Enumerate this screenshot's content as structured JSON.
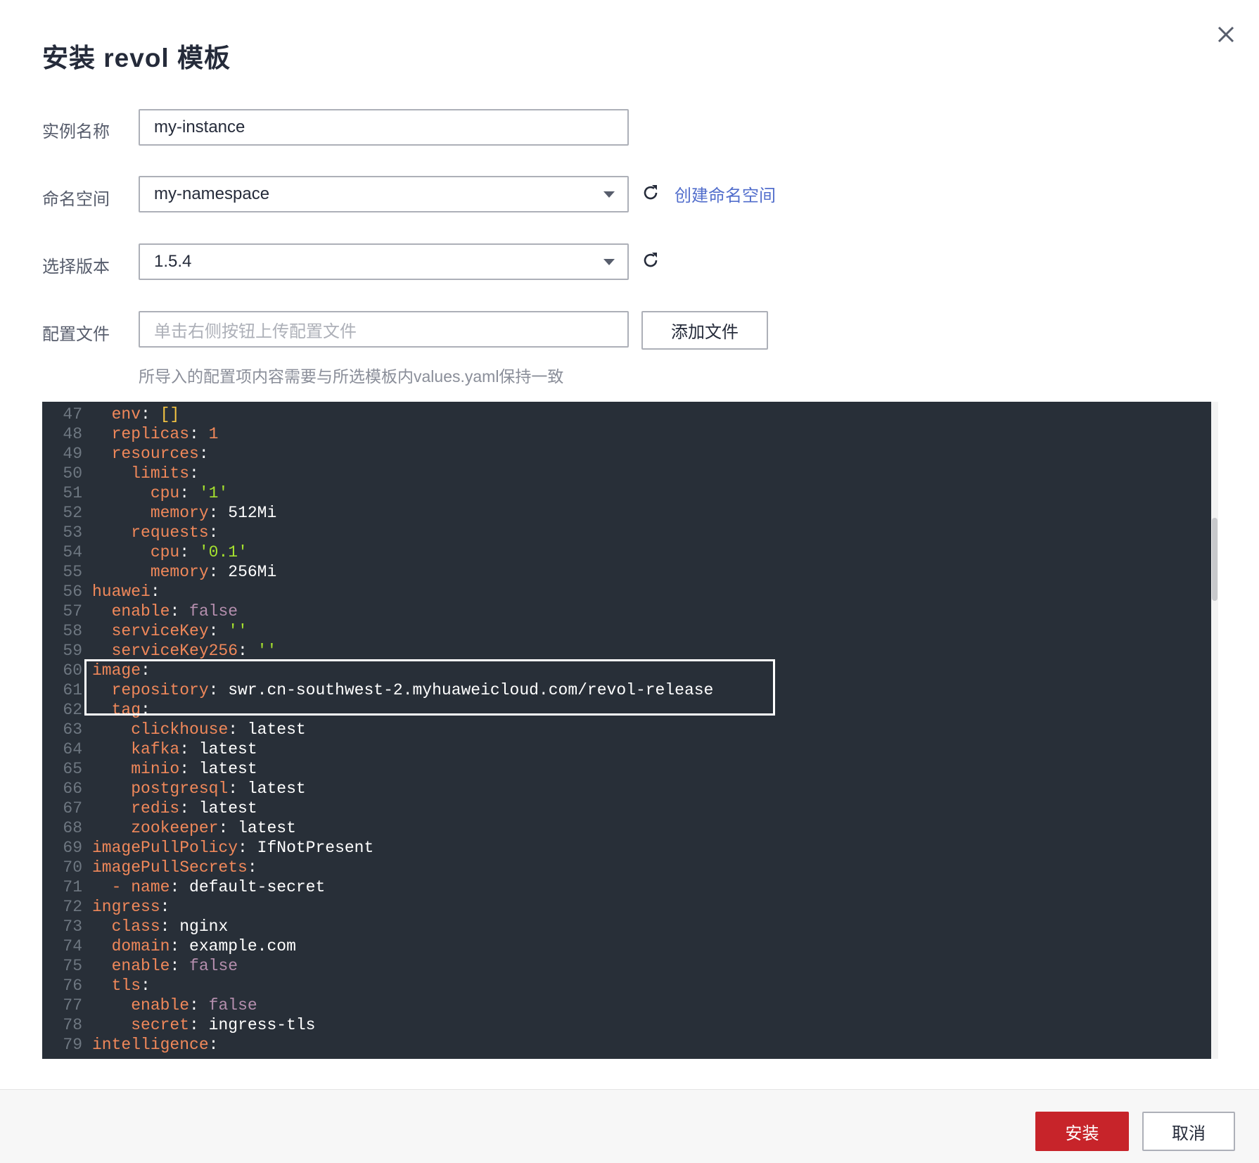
{
  "dialog": {
    "title": "安装 revol 模板",
    "close_icon": "close-icon"
  },
  "form": {
    "instance_name": {
      "label": "实例名称",
      "value": "my-instance"
    },
    "namespace": {
      "label": "命名空间",
      "value": "my-namespace",
      "create_link": "创建命名空间"
    },
    "version": {
      "label": "选择版本",
      "value": "1.5.4"
    },
    "config_file": {
      "label": "配置文件",
      "placeholder": "单击右侧按钮上传配置文件",
      "add_button": "添加文件",
      "hint": "所导入的配置项内容需要与所选模板内values.yaml保持一致"
    }
  },
  "editor": {
    "lines": [
      {
        "n": "47",
        "indent": "  ",
        "key": "env",
        "sep": ": ",
        "val": "[]",
        "type": "punct"
      },
      {
        "n": "48",
        "indent": "  ",
        "key": "replicas",
        "sep": ": ",
        "val": "1",
        "type": "num"
      },
      {
        "n": "49",
        "indent": "  ",
        "key": "resources",
        "sep": ":",
        "val": "",
        "type": "plain"
      },
      {
        "n": "50",
        "indent": "    ",
        "key": "limits",
        "sep": ":",
        "val": "",
        "type": "plain"
      },
      {
        "n": "51",
        "indent": "      ",
        "key": "cpu",
        "sep": ": ",
        "val": "'1'",
        "type": "str"
      },
      {
        "n": "52",
        "indent": "      ",
        "key": "memory",
        "sep": ": ",
        "val": "512Mi",
        "type": "plain"
      },
      {
        "n": "53",
        "indent": "    ",
        "key": "requests",
        "sep": ":",
        "val": "",
        "type": "plain"
      },
      {
        "n": "54",
        "indent": "      ",
        "key": "cpu",
        "sep": ": ",
        "val": "'0.1'",
        "type": "str"
      },
      {
        "n": "55",
        "indent": "      ",
        "key": "memory",
        "sep": ": ",
        "val": "256Mi",
        "type": "plain"
      },
      {
        "n": "56",
        "indent": "",
        "key": "huawei",
        "sep": ":",
        "val": "",
        "type": "plain"
      },
      {
        "n": "57",
        "indent": "  ",
        "key": "enable",
        "sep": ": ",
        "val": "false",
        "type": "bool"
      },
      {
        "n": "58",
        "indent": "  ",
        "key": "serviceKey",
        "sep": ": ",
        "val": "''",
        "type": "str"
      },
      {
        "n": "59",
        "indent": "  ",
        "key": "serviceKey256",
        "sep": ": ",
        "val": "''",
        "type": "str"
      },
      {
        "n": "60",
        "indent": "",
        "key": "image",
        "sep": ":",
        "val": "",
        "type": "plain"
      },
      {
        "n": "61",
        "indent": "  ",
        "key": "repository",
        "sep": ": ",
        "val": "swr.cn-southwest-2.myhuaweicloud.com/revol-release",
        "type": "plain"
      },
      {
        "n": "62",
        "indent": "  ",
        "key": "tag",
        "sep": ":",
        "val": "",
        "type": "plain"
      },
      {
        "n": "63",
        "indent": "    ",
        "key": "clickhouse",
        "sep": ": ",
        "val": "latest",
        "type": "plain"
      },
      {
        "n": "64",
        "indent": "    ",
        "key": "kafka",
        "sep": ": ",
        "val": "latest",
        "type": "plain"
      },
      {
        "n": "65",
        "indent": "    ",
        "key": "minio",
        "sep": ": ",
        "val": "latest",
        "type": "plain"
      },
      {
        "n": "66",
        "indent": "    ",
        "key": "postgresql",
        "sep": ": ",
        "val": "latest",
        "type": "plain"
      },
      {
        "n": "67",
        "indent": "    ",
        "key": "redis",
        "sep": ": ",
        "val": "latest",
        "type": "plain"
      },
      {
        "n": "68",
        "indent": "    ",
        "key": "zookeeper",
        "sep": ": ",
        "val": "latest",
        "type": "plain"
      },
      {
        "n": "69",
        "indent": "",
        "key": "imagePullPolicy",
        "sep": ": ",
        "val": "IfNotPresent",
        "type": "plain"
      },
      {
        "n": "70",
        "indent": "",
        "key": "imagePullSecrets",
        "sep": ":",
        "val": "",
        "type": "plain"
      },
      {
        "n": "71",
        "indent": "  ",
        "key": "- name",
        "sep": ": ",
        "val": "default-secret",
        "type": "plain"
      },
      {
        "n": "72",
        "indent": "",
        "key": "ingress",
        "sep": ":",
        "val": "",
        "type": "plain"
      },
      {
        "n": "73",
        "indent": "  ",
        "key": "class",
        "sep": ": ",
        "val": "nginx",
        "type": "plain"
      },
      {
        "n": "74",
        "indent": "  ",
        "key": "domain",
        "sep": ": ",
        "val": "example.com",
        "type": "plain"
      },
      {
        "n": "75",
        "indent": "  ",
        "key": "enable",
        "sep": ": ",
        "val": "false",
        "type": "bool"
      },
      {
        "n": "76",
        "indent": "  ",
        "key": "tls",
        "sep": ":",
        "val": "",
        "type": "plain"
      },
      {
        "n": "77",
        "indent": "    ",
        "key": "enable",
        "sep": ": ",
        "val": "false",
        "type": "bool"
      },
      {
        "n": "78",
        "indent": "    ",
        "key": "secret",
        "sep": ": ",
        "val": "ingress-tls",
        "type": "plain"
      },
      {
        "n": "79",
        "indent": "",
        "key": "intelligence",
        "sep": ":",
        "val": "",
        "type": "plain"
      }
    ]
  },
  "footer": {
    "install_label": "安装",
    "cancel_label": "取消"
  },
  "colors": {
    "primary": "#c7242a",
    "link": "#526ecc",
    "editor_bg": "#282f38"
  }
}
